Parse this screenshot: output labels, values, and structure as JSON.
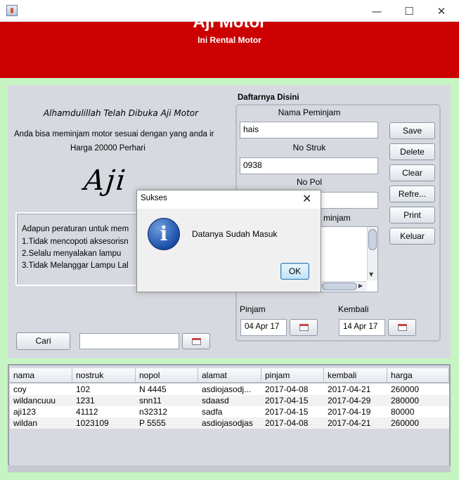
{
  "window": {
    "title": "",
    "controls": {
      "minimize": "—",
      "maximize": "☐",
      "close": "✕"
    }
  },
  "header": {
    "title": "Aji Motor",
    "subtitle": "Ini Rental Motor",
    "bg_color": "#cc0000"
  },
  "left_panel": {
    "welcome": "Alhamdulillah Telah Dibuka Aji Motor",
    "description": "Anda bisa meminjam motor sesuai dengan yang anda ir",
    "price": "Harga 20000 Perhari",
    "signature": "Aji",
    "rules": [
      "Adapun peraturan untuk mem",
      "1.Tidak mencopoti aksesorisn",
      "2.Selalu menyalakan lampu",
      "3.Tidak Melanggar Lampu Lal"
    ]
  },
  "form": {
    "group_title": "Daftarnya Disini",
    "nama_label": "Nama Peminjam",
    "nama_value": "hais",
    "struk_label": "No Struk",
    "struk_value": "0938",
    "pol_label": "No Pol",
    "alamat_label_partial": "minjam",
    "pinjam_label": "Pinjam",
    "pinjam_value": "04 Apr 17",
    "kembali_label": "Kembali",
    "kembali_value": "14 Apr 17"
  },
  "buttons": {
    "save": "Save",
    "delete": "Delete",
    "clear": "Clear",
    "refresh": "Refre...",
    "print": "Print",
    "keluar": "Keluar",
    "cari": "Cari"
  },
  "search": {
    "value": ""
  },
  "table": {
    "columns": [
      "nama",
      "nostruk",
      "nopol",
      "alamat",
      "pinjam",
      "kembali",
      "harga"
    ],
    "rows": [
      [
        "coy",
        "102",
        "N 4445",
        "asdiojasodj...",
        "2017-04-08",
        "2017-04-21",
        "260000"
      ],
      [
        "wildancuuu",
        "1231",
        "snn11",
        "sdaasd",
        "2017-04-15",
        "2017-04-29",
        "280000"
      ],
      [
        "aji123",
        "41112",
        "n32312",
        "sadfa",
        "2017-04-15",
        "2017-04-19",
        "80000"
      ],
      [
        "wildan",
        "1023109",
        "P 5555",
        "asdiojasodjas",
        "2017-04-08",
        "2017-04-21",
        "260000"
      ]
    ]
  },
  "dialog": {
    "title": "Sukses",
    "message": "Datanya Sudah Masuk",
    "ok": "OK",
    "close": "✕",
    "icon": "info-icon"
  }
}
